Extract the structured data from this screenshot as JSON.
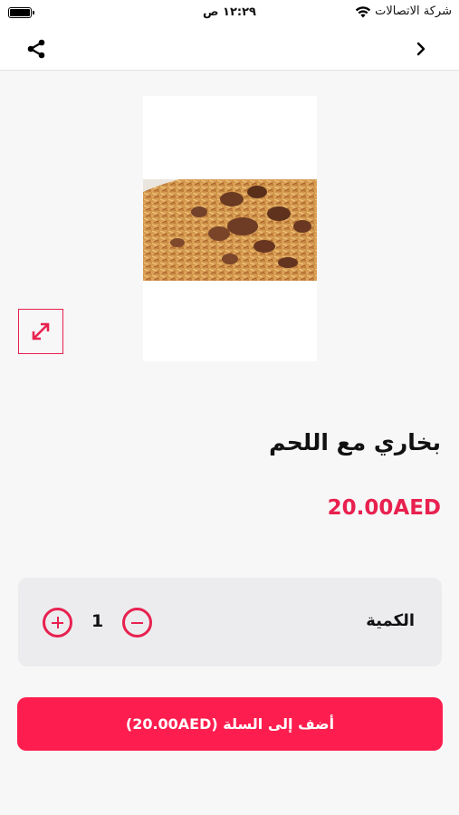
{
  "status_bar": {
    "carrier": "شركة الاتصالات",
    "time": "١٢:٢٩ ص"
  },
  "nav": {
    "share_icon": "share-icon",
    "back_icon": "chevron-right-icon"
  },
  "product": {
    "image_icon": "food-photo",
    "expand_icon": "expand-diagonal-icon",
    "name": "بخاري مع اللحم",
    "price": "20.00AED"
  },
  "quantity": {
    "label": "الكمية",
    "value": "1",
    "plus_icon": "plus-circle-icon",
    "minus_icon": "minus-circle-icon"
  },
  "cart": {
    "add_label": "أضف إلى السلة (20.00AED)"
  },
  "colors": {
    "accent": "#fd1d4e",
    "accent_dark": "#e8214f",
    "background": "#f7f7f7",
    "card": "#ececef"
  }
}
